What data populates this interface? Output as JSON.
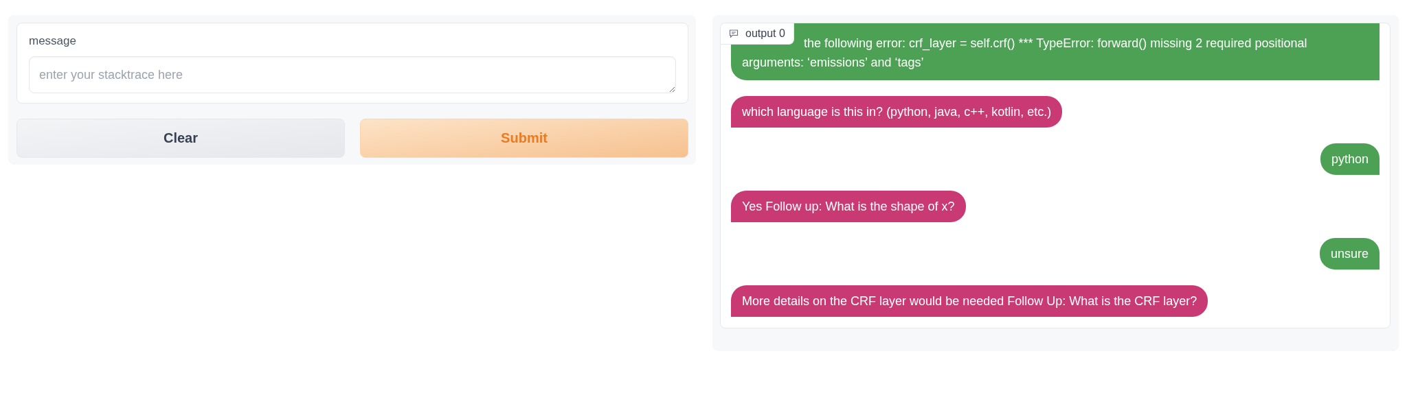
{
  "input_panel": {
    "label": "message",
    "placeholder": "enter your stacktrace here"
  },
  "buttons": [
    {
      "label": "Clear",
      "kind": "secondary"
    },
    {
      "label": "Submit",
      "kind": "primary"
    }
  ],
  "output_panel": {
    "label": "output 0",
    "messages": [
      {
        "kind": "user",
        "text": "the following error: crf_layer = self.crf() *** TypeError: forward() missing 2 required positional arguments: ‘emissions’ and ‘tags’"
      },
      {
        "kind": "bot",
        "text": "which language is this in? (python, java, c++, kotlin, etc.)"
      },
      {
        "kind": "user",
        "text": "python"
      },
      {
        "kind": "bot",
        "text": "Yes Follow up: What is the shape of x?"
      },
      {
        "kind": "user",
        "text": "unsure"
      },
      {
        "kind": "bot",
        "text": "More details on the CRF layer would be needed Follow Up: What is the CRF layer?"
      }
    ]
  }
}
